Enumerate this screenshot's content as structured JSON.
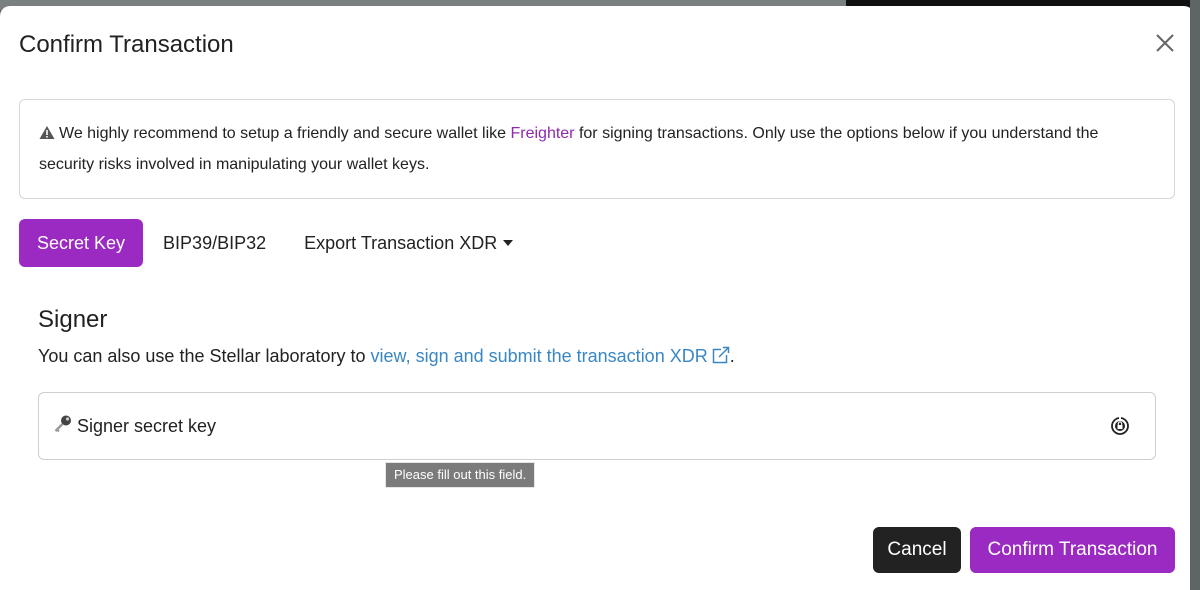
{
  "modal": {
    "title": "Confirm Transaction",
    "close_icon": "close-icon"
  },
  "alert": {
    "icon": "warning-icon",
    "text_before": "We highly recommend to setup a friendly and secure wallet like ",
    "link_label": "Freighter",
    "text_after": " for signing transactions. Only use the options below if you understand the security risks involved in manipulating your wallet keys.",
    "link_color": "#8e2aac"
  },
  "tabs": [
    {
      "label": "Secret Key",
      "active": true
    },
    {
      "label": "BIP39/BIP32",
      "active": false
    },
    {
      "label": "Export Transaction XDR",
      "active": false,
      "dropdown": true
    }
  ],
  "signer": {
    "heading": "Signer",
    "desc_before": "You can also use the Stellar laboratory to ",
    "link_label": "view, sign and submit the transaction XDR",
    "desc_after": ".",
    "link_color": "#3a87c6",
    "input_placeholder": "Signer secret key",
    "input_value": "",
    "key_icon": "key-icon",
    "password_manager_icon": "password-manager-icon",
    "tooltip": "Please fill out this field."
  },
  "footer": {
    "cancel_label": "Cancel",
    "confirm_label": "Confirm Transaction"
  },
  "colors": {
    "accent": "#9b2ac3",
    "cancel_bg": "#222222"
  }
}
